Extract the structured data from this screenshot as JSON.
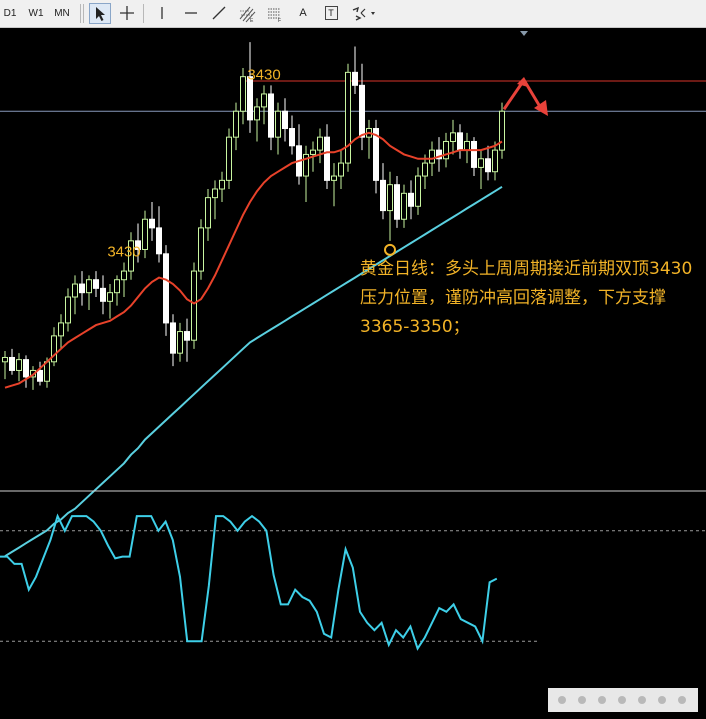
{
  "toolbar": {
    "timeframes": [
      "D1",
      "W1",
      "MN"
    ],
    "tools": [
      "cursor-icon",
      "crosshair-icon",
      "vertical-line-icon",
      "horizontal-line-icon",
      "trendline-icon",
      "fibonacci-channel-icon",
      "fibonacci-fan-icon",
      "text-icon",
      "text-label-icon",
      "arrow-shapes-icon"
    ],
    "text_tool_label": "A",
    "text_label_tool_label": "T"
  },
  "annotation": {
    "text": "黄金日线：多头上周周期接近前期双顶3430压力位置，谨防冲高回落调整，下方支撑3365-3350；"
  },
  "colors": {
    "bull_candle": "#c8f5a0",
    "bear_candle": "#ffffff",
    "ma_short": "#e8422a",
    "ma_long": "#5ad0e0",
    "oscillator": "#3ecfe8",
    "resistance_line": "#d9342a",
    "current_price_line": "#8899bb",
    "annotation_text": "#f2b327",
    "arrow": "#e8423a"
  },
  "chart_data": {
    "type": "candlestick",
    "peak_labels": [
      {
        "text": "3430",
        "index": 17
      },
      {
        "text": "3430",
        "index": 37
      }
    ],
    "resistance_level": 3430,
    "support_marker_index": 55,
    "candles": [
      [
        3300,
        3305,
        3292,
        3302
      ],
      [
        3302,
        3306,
        3294,
        3296
      ],
      [
        3296,
        3304,
        3291,
        3301
      ],
      [
        3301,
        3303,
        3288,
        3293
      ],
      [
        3293,
        3298,
        3287,
        3296
      ],
      [
        3296,
        3300,
        3289,
        3291
      ],
      [
        3291,
        3302,
        3288,
        3300
      ],
      [
        3300,
        3316,
        3298,
        3312
      ],
      [
        3312,
        3322,
        3306,
        3318
      ],
      [
        3318,
        3334,
        3314,
        3330
      ],
      [
        3330,
        3340,
        3322,
        3336
      ],
      [
        3336,
        3342,
        3326,
        3332
      ],
      [
        3332,
        3340,
        3324,
        3338
      ],
      [
        3338,
        3342,
        3330,
        3334
      ],
      [
        3334,
        3340,
        3322,
        3328
      ],
      [
        3328,
        3336,
        3320,
        3332
      ],
      [
        3332,
        3340,
        3326,
        3338
      ],
      [
        3338,
        3346,
        3330,
        3342
      ],
      [
        3342,
        3360,
        3338,
        3356
      ],
      [
        3356,
        3364,
        3346,
        3352
      ],
      [
        3352,
        3370,
        3348,
        3366
      ],
      [
        3366,
        3374,
        3356,
        3362
      ],
      [
        3362,
        3372,
        3346,
        3350
      ],
      [
        3350,
        3354,
        3312,
        3318
      ],
      [
        3318,
        3322,
        3298,
        3304
      ],
      [
        3304,
        3318,
        3300,
        3314
      ],
      [
        3314,
        3320,
        3300,
        3310
      ],
      [
        3310,
        3346,
        3306,
        3342
      ],
      [
        3342,
        3366,
        3338,
        3362
      ],
      [
        3362,
        3380,
        3356,
        3376
      ],
      [
        3376,
        3384,
        3366,
        3380
      ],
      [
        3380,
        3388,
        3374,
        3384
      ],
      [
        3384,
        3408,
        3380,
        3404
      ],
      [
        3404,
        3420,
        3398,
        3416
      ],
      [
        3416,
        3436,
        3410,
        3432
      ],
      [
        3432,
        3448,
        3406,
        3412
      ],
      [
        3412,
        3422,
        3402,
        3418
      ],
      [
        3418,
        3428,
        3410,
        3424
      ],
      [
        3424,
        3428,
        3398,
        3404
      ],
      [
        3404,
        3420,
        3396,
        3416
      ],
      [
        3416,
        3422,
        3402,
        3408
      ],
      [
        3408,
        3414,
        3396,
        3400
      ],
      [
        3400,
        3410,
        3382,
        3386
      ],
      [
        3386,
        3400,
        3374,
        3396
      ],
      [
        3396,
        3402,
        3388,
        3398
      ],
      [
        3398,
        3408,
        3392,
        3404
      ],
      [
        3404,
        3410,
        3380,
        3384
      ],
      [
        3384,
        3392,
        3372,
        3386
      ],
      [
        3386,
        3398,
        3380,
        3392
      ],
      [
        3392,
        3438,
        3388,
        3434
      ],
      [
        3434,
        3446,
        3424,
        3428
      ],
      [
        3428,
        3438,
        3398,
        3404
      ],
      [
        3404,
        3412,
        3394,
        3408
      ],
      [
        3408,
        3412,
        3378,
        3384
      ],
      [
        3384,
        3392,
        3366,
        3370
      ],
      [
        3370,
        3388,
        3356,
        3382
      ],
      [
        3382,
        3386,
        3362,
        3366
      ],
      [
        3366,
        3382,
        3362,
        3378
      ],
      [
        3378,
        3384,
        3366,
        3372
      ],
      [
        3372,
        3390,
        3368,
        3386
      ],
      [
        3386,
        3396,
        3380,
        3392
      ],
      [
        3392,
        3402,
        3386,
        3398
      ],
      [
        3398,
        3404,
        3388,
        3394
      ],
      [
        3394,
        3406,
        3390,
        3402
      ],
      [
        3402,
        3412,
        3396,
        3406
      ],
      [
        3406,
        3410,
        3394,
        3398
      ],
      [
        3398,
        3406,
        3392,
        3402
      ],
      [
        3402,
        3404,
        3386,
        3390
      ],
      [
        3390,
        3398,
        3380,
        3394
      ],
      [
        3394,
        3400,
        3384,
        3388
      ],
      [
        3388,
        3402,
        3384,
        3398
      ],
      [
        3398,
        3420,
        3394,
        3416
      ]
    ],
    "ma_short": [
      3288,
      3289,
      3290,
      3292,
      3294,
      3297,
      3300,
      3303,
      3306,
      3309,
      3311,
      3313,
      3315,
      3317,
      3318,
      3319,
      3321,
      3323,
      3326,
      3330,
      3334,
      3337,
      3339,
      3338,
      3336,
      3333,
      3329,
      3327,
      3329,
      3334,
      3340,
      3347,
      3354,
      3361,
      3368,
      3374,
      3379,
      3383,
      3386,
      3388,
      3390,
      3392,
      3393,
      3394,
      3395,
      3396,
      3397,
      3397,
      3398,
      3400,
      3403,
      3405,
      3406,
      3405,
      3403,
      3400,
      3398,
      3396,
      3395,
      3394,
      3394,
      3394,
      3395,
      3396,
      3397,
      3398,
      3398,
      3398,
      3398,
      3399,
      3400,
      3402
    ],
    "ma_long": [
      3210,
      3212,
      3214,
      3216,
      3218,
      3220,
      3222,
      3225,
      3227,
      3230,
      3232,
      3235,
      3238,
      3241,
      3244,
      3247,
      3250,
      3253,
      3257,
      3260,
      3264,
      3267,
      3270,
      3273,
      3276,
      3279,
      3282,
      3285,
      3288,
      3291,
      3294,
      3297,
      3300,
      3303,
      3306,
      3309,
      3311,
      3313,
      3315,
      3317,
      3319,
      3321,
      3323,
      3325,
      3327,
      3329,
      3331,
      3333,
      3335,
      3337,
      3339,
      3341,
      3343,
      3345,
      3347,
      3349,
      3351,
      3353,
      3355,
      3357,
      3359,
      3361,
      3363,
      3365,
      3367,
      3369,
      3371,
      3373,
      3375,
      3377,
      3379,
      3381
    ],
    "oscillator": [
      66,
      66,
      62,
      62,
      48,
      55,
      65,
      75,
      88,
      80,
      88,
      88,
      88,
      85,
      80,
      72,
      65,
      66,
      66,
      88,
      88,
      88,
      80,
      85,
      75,
      55,
      20,
      20,
      20,
      50,
      88,
      88,
      85,
      80,
      85,
      88,
      85,
      80,
      56,
      40,
      40,
      48,
      44,
      42,
      36,
      24,
      22,
      48,
      70,
      60,
      36,
      30,
      26,
      30,
      18,
      26,
      22,
      28,
      16,
      22,
      30,
      38,
      36,
      40,
      32,
      30,
      28,
      20,
      52,
      54
    ]
  }
}
